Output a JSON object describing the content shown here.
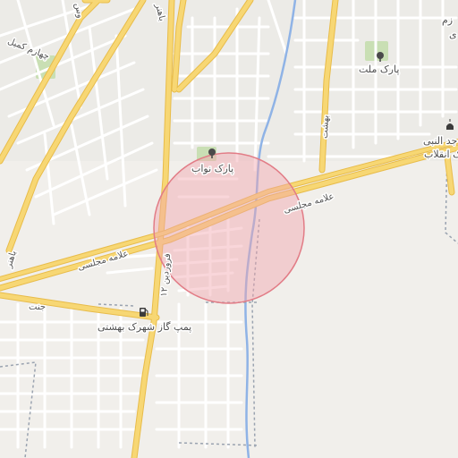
{
  "map": {
    "colors": {
      "land": "#f1efeb",
      "park": "#c9dfb4",
      "major_road": "#f7d774",
      "major_road_casing": "#e8bc4a",
      "minor_road": "#ffffff",
      "river": "#8fb3e6",
      "boundary": "#9aa3b0",
      "highlight_fill": "#f2a3ad",
      "highlight_stroke": "#e27c86"
    },
    "labels": {
      "allameh_majlesi_west": "علامه مجلسی",
      "allameh_majlesi_east": "علامه مجلسی",
      "farvardin": "۱۲ فروردین",
      "bahonar_top": "باهنر",
      "bahonar_left": "باهنر",
      "chamran_kamil": "چهارم کمیل",
      "behesht": "بهشت",
      "janat": "جنت",
      "navvab_park": "پارک نواب",
      "mellat_park": "پارک ملت",
      "gas_station": "پمپ گاز شهرک بهشتی",
      "masjed_nabi": "جد النبی",
      "enghelab": "ک انقلاب",
      "top_right_fragment": "زم",
      "top_right_fragment2": "ی",
      "top_left_fragment": "وس"
    },
    "icons": {
      "navvab_park": "tree-icon",
      "mellat_park": "tree-icon",
      "gas_station": "fuel-pump-icon",
      "masjed_nabi": "mosque-icon"
    }
  }
}
